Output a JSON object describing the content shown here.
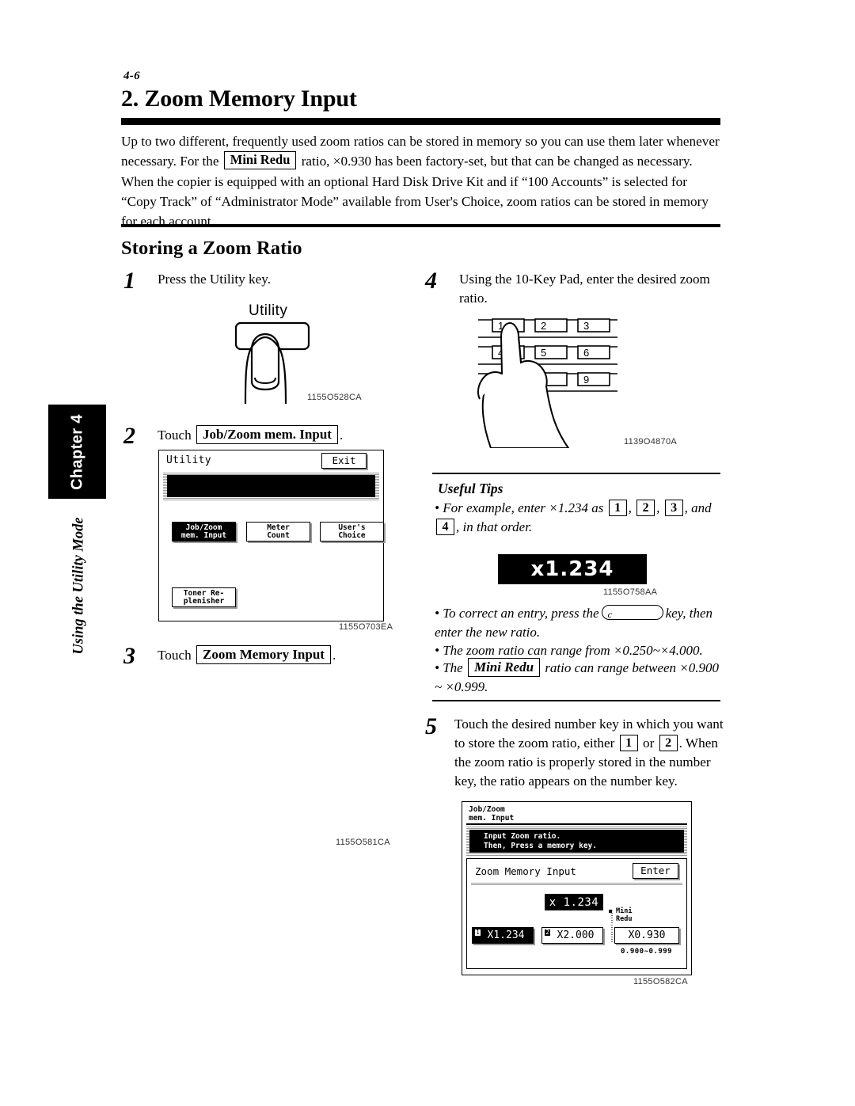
{
  "page": {
    "folio": "4-6",
    "title": "2. Zoom Memory Input",
    "intro_1": "Up to two different, frequently used zoom ratios can be stored in memory so you can use them later whenever necessary. For the",
    "intro_key": "Mini Redu",
    "intro_2": "ratio, ×0.930 has been factory-set, but that can be changed as necessary. When the copier is equipped with an optional Hard Disk Drive Kit and if “100 Accounts” is selected for “Copy Track” of “Administrator Mode” available from User's Choice, zoom ratios can be stored in memory for each account.",
    "section_title": "Storing a Zoom Ratio"
  },
  "sidebar": {
    "chapter": "Chapter 4",
    "subtitle": "Using the Utility Mode"
  },
  "steps": {
    "s1": {
      "num": "1",
      "text": "Press the Utility key."
    },
    "s2": {
      "num": "2",
      "lead": "Touch",
      "key": "Job/Zoom mem. Input",
      "tail": "."
    },
    "s3": {
      "num": "3",
      "lead": "Touch",
      "key": "Zoom Memory Input",
      "tail": "."
    },
    "s4": {
      "num": "4",
      "text": "Using the 10-Key Pad, enter the desired zoom ratio."
    },
    "s5": {
      "num": "5",
      "t1": "Touch the desired number key in which you want to store the zoom ratio, either",
      "k1": "1",
      "t2": "or",
      "k2": "2",
      "t3": ". When the zoom ratio is properly stored in the number key, the ratio appears on the number key."
    }
  },
  "fig_utility": {
    "label": "Utility",
    "code": "1155O528CA"
  },
  "fig_keypad": {
    "keys": [
      "1",
      "2",
      "3",
      "4",
      "5",
      "6",
      "9"
    ],
    "code": "1139O4870A"
  },
  "lcd_utility": {
    "title": "Utility",
    "exit": "Exit",
    "buttons": [
      {
        "l1": "Job/Zoom",
        "l2": "mem. Input",
        "selected": true
      },
      {
        "l1": "Meter",
        "l2": "Count",
        "selected": false
      },
      {
        "l1": "User's",
        "l2": "Choice",
        "selected": false
      },
      {
        "l1": "Toner Re-",
        "l2": "plenisher",
        "selected": false
      }
    ],
    "code": "1155O703EA"
  },
  "step3_code": "1155O581CA",
  "tips": {
    "title": "Useful Tips",
    "b1_a": "For example, enter ×1.234 as",
    "b1_k1": "1",
    "b1_k2": "2",
    "b1_k3": "3",
    "b1_b": "and",
    "b1_k4": "4",
    "b1_c": ", in that order.",
    "display_value": "x1.234",
    "display_code": "1155O758AA",
    "b2_a": "To correct an entry, press the",
    "b2_ckey": "c",
    "b2_b": "key, then enter the new ratio.",
    "b3": "The zoom ratio can range from ×0.250~×4.000.",
    "b4_a": "The",
    "b4_key": "Mini Redu",
    "b4_b": "ratio can range between ×0.900 ~ ×0.999."
  },
  "lcd_zoom": {
    "hdr_l1": "Job/Zoom",
    "hdr_l2": "mem. Input",
    "msg_l1": "Input Zoom ratio.",
    "msg_l2": "Then, Press a memory key.",
    "sub_title": "Zoom Memory Input",
    "enter": "Enter",
    "value_display": "x 1.234",
    "mini_l1": "Mini",
    "mini_l2": "Redu",
    "mem1_index": "1",
    "mem1_value": "X1.234",
    "mem2_index": "2",
    "mem2_value": "X2.000",
    "mini_value": "X0.930",
    "mini_range": "0.900~0.999",
    "code": "1155O582CA"
  },
  "colors": {
    "ink": "#000000",
    "paper": "#ffffff",
    "gray": "#808080"
  }
}
